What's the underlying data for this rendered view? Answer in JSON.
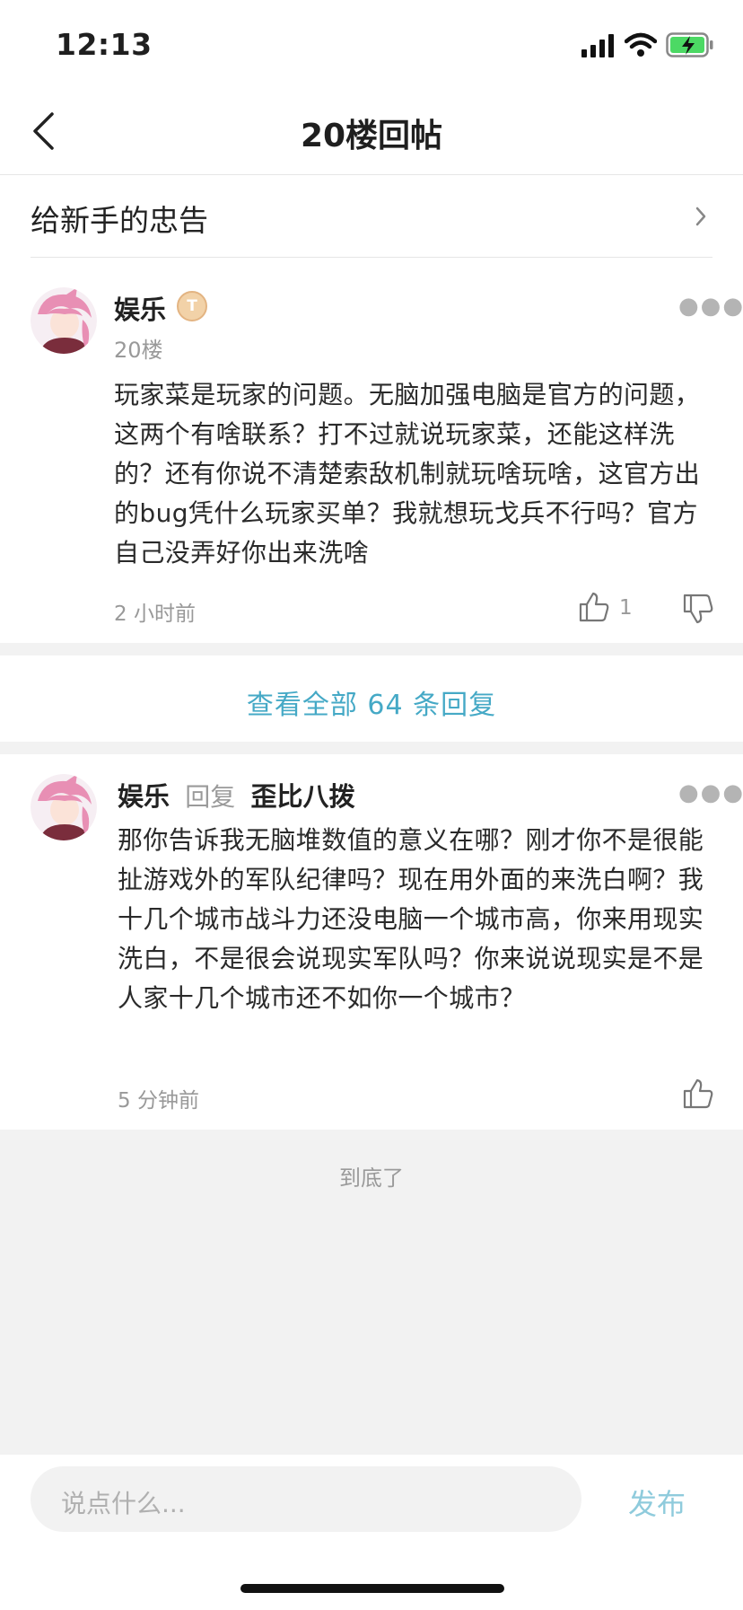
{
  "status_bar": {
    "time": "12:13"
  },
  "nav": {
    "title": "20楼回帖"
  },
  "thread": {
    "title": "给新手的忠告"
  },
  "post": {
    "author": "娱乐",
    "floor": "20楼",
    "content": "玩家菜是玩家的问题。无脑加强电脑是官方的问题，这两个有啥联系？打不过就说玩家菜，还能这样洗的？还有你说不清楚索敌机制就玩啥玩啥，这官方出的bug凭什么玩家买单？我就想玩戈兵不行吗？官方自己没弄好你出来洗啥",
    "time": "2 小时前",
    "like_count": "1"
  },
  "view_all_replies": "查看全部 64 条回复",
  "reply": {
    "author": "娱乐",
    "reply_word": "回复",
    "reply_to": "歪比八拨",
    "content": "那你告诉我无脑堆数值的意义在哪？刚才你不是很能扯游戏外的军队纪律吗？现在用外面的来洗白啊？我十几个城市战斗力还没电脑一个城市高，你来用现实洗白，不是很会说现实军队吗？你来说说现实是不是人家十几个城市还不如你一个城市？",
    "time": "5 分钟前"
  },
  "end_text": "到底了",
  "composer": {
    "placeholder": "说点什么...",
    "publish_label": "发布"
  },
  "colors": {
    "accent": "#45a9c6",
    "publish": "#8fcbdc",
    "background": "#f2f2f2"
  },
  "icons": {
    "back": "chevron-left-icon",
    "more": "more-dots-icon",
    "like": "thumbs-up-icon",
    "dislike": "thumbs-down-icon",
    "badge": "level-badge-icon"
  }
}
